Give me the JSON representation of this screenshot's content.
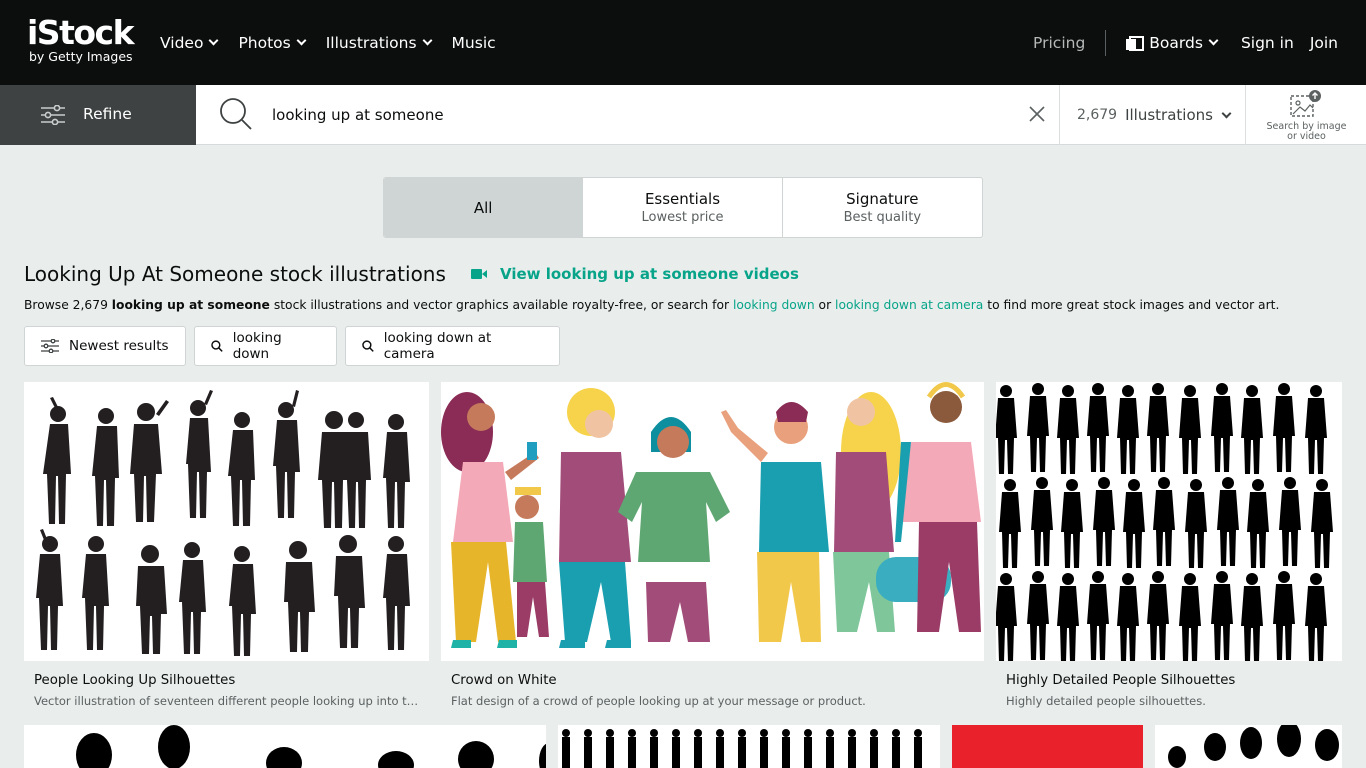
{
  "nav": {
    "logo_main": "iStock",
    "logo_sub": "by Getty Images",
    "links": [
      {
        "label": "Video",
        "has_menu": true
      },
      {
        "label": "Photos",
        "has_menu": true
      },
      {
        "label": "Illustrations",
        "has_menu": true
      },
      {
        "label": "Music",
        "has_menu": false
      }
    ],
    "pricing": "Pricing",
    "boards": "Boards",
    "signin": "Sign in",
    "join": "Join"
  },
  "search": {
    "refine": "Refine",
    "query": "looking up at someone",
    "result_count": "2,679",
    "media_type": "Illustrations",
    "search_by_image_line1": "Search by image",
    "search_by_image_line2": "or video"
  },
  "tabs": [
    {
      "title": "All",
      "subtitle": "",
      "active": true
    },
    {
      "title": "Essentials",
      "subtitle": "Lowest price",
      "active": false
    },
    {
      "title": "Signature",
      "subtitle": "Best quality",
      "active": false
    }
  ],
  "heading": {
    "title": "Looking Up At Someone stock illustrations",
    "video_link": "View looking up at someone videos",
    "browse_prefix": "Browse 2,679 ",
    "browse_term": "looking up at someone",
    "browse_mid": " stock illustrations and vector graphics available royalty-free, or search for ",
    "browse_link1": "looking down",
    "browse_or": " or ",
    "browse_link2": "looking down at camera",
    "browse_suffix": " to find more great stock images and vector art."
  },
  "chips": [
    {
      "label": "Newest results",
      "icon": "sliders-icon"
    },
    {
      "label": "looking down",
      "icon": "search-icon"
    },
    {
      "label": "looking down at camera",
      "icon": "search-icon"
    }
  ],
  "results": [
    {
      "title": "People Looking Up Silhouettes",
      "description": "Vector illustration of seventeen different people looking up into th..."
    },
    {
      "title": "Crowd on White",
      "description": "Flat design of a crowd of people looking up at your message or product."
    },
    {
      "title": "Highly Detailed People Silhouettes",
      "description": "Highly detailed people silhouettes."
    }
  ],
  "colors": {
    "nav_bg": "#0c0d0d",
    "accent": "#08a489",
    "page_bg": "#e9eeed",
    "refine_bg": "#3e4242"
  }
}
